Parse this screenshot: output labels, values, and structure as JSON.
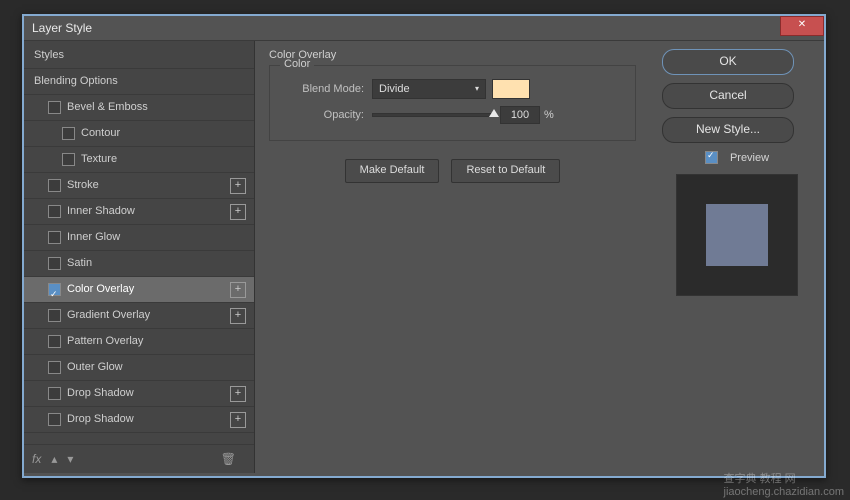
{
  "window": {
    "title": "Layer Style"
  },
  "styles": {
    "header": "Styles",
    "blending": "Blending Options",
    "bevel": "Bevel & Emboss",
    "contour": "Contour",
    "texture": "Texture",
    "stroke": "Stroke",
    "innerShadow": "Inner Shadow",
    "innerGlow": "Inner Glow",
    "satin": "Satin",
    "colorOverlay": "Color Overlay",
    "gradientOverlay": "Gradient Overlay",
    "patternOverlay": "Pattern Overlay",
    "outerGlow": "Outer Glow",
    "dropShadow1": "Drop Shadow",
    "dropShadow2": "Drop Shadow"
  },
  "panel": {
    "title": "Color Overlay",
    "group": "Color",
    "blendModeLabel": "Blend Mode:",
    "blendModeValue": "Divide",
    "opacityLabel": "Opacity:",
    "opacityValue": "100",
    "opacityUnit": "%",
    "swatchColor": "#ffe1b0",
    "makeDefault": "Make Default",
    "resetDefault": "Reset to Default"
  },
  "side": {
    "ok": "OK",
    "cancel": "Cancel",
    "newStyle": "New Style...",
    "preview": "Preview"
  },
  "footer": {
    "fx": "fx"
  },
  "watermark": {
    "line1": "查字典 教程 网",
    "line2": "jiaocheng.chazidian.com"
  }
}
